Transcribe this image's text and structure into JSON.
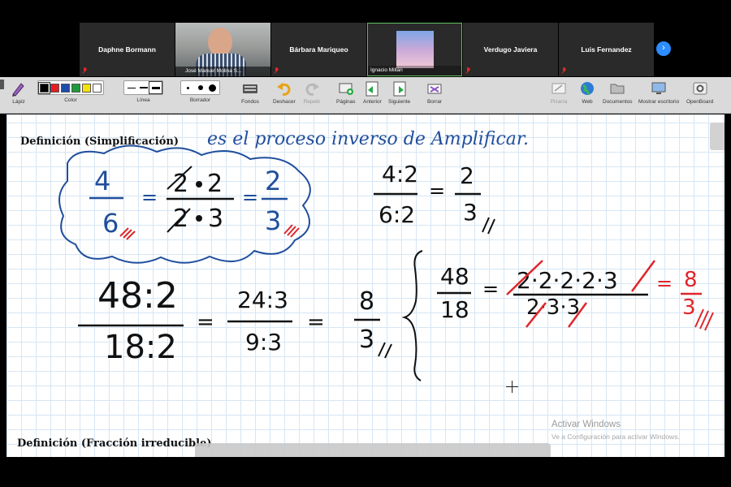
{
  "participants": [
    {
      "name": "Daphne Bormann",
      "muted": true
    },
    {
      "name": "José Manuel Molina S...",
      "muted": false,
      "video": true
    },
    {
      "name": "Bárbara Mariqueo",
      "muted": true
    },
    {
      "name": "Ignacio Millán",
      "muted": false,
      "photo": true
    },
    {
      "name": "Verdugo Javiera",
      "muted": true
    },
    {
      "name": "Luis Fernandez",
      "muted": true
    }
  ],
  "toolbar": {
    "pen": "Lápiz",
    "color": "Color",
    "line": "Línea",
    "eraser": "Borrador",
    "backgrounds": "Fondos",
    "undo": "Deshacer",
    "redo": "Repetir",
    "pages": "Páginas",
    "previous": "Anterior",
    "next": "Siguiente",
    "clear": "Borrar",
    "board": "Pizarra",
    "web": "Web",
    "documents": "Documentos",
    "show_desktop": "Mostrar escritorio",
    "openboard": "OpenBoard"
  },
  "colors": {
    "swatches": [
      "#000000",
      "#e31e24",
      "#1d4ea8",
      "#1f9a3a",
      "#f4e20b"
    ],
    "ink_blue": "#1f4e9c",
    "ink_black": "#111111",
    "ink_red": "#e0252a",
    "accent": "#2d8cff"
  },
  "board": {
    "title_1": "Definición (Simplificación)",
    "handwriting_1": "es el proceso inverso de Amplificar.",
    "title_2": "Definición (Fracción irreducible)",
    "ink": {
      "n4": "4",
      "n6": "6",
      "n2a": "2",
      "n2b": "2",
      "n3a": "3",
      "n2c": "2",
      "n3b": "3",
      "eq": "=",
      "d4": "4:2",
      "d6": "6:2",
      "r2": "2",
      "r3": "3",
      "big48": "48:2",
      "big18": "18:2",
      "m24": "24:3",
      "m9": "9:3",
      "f8": "8",
      "f3": "3",
      "b48": "48",
      "b18": "18",
      "prod_top": "2·2·2·2·3",
      "prod_bot": "2·3·3",
      "res8": "8",
      "res3": "3"
    }
  },
  "watermark": {
    "line1": "Activar Windows",
    "line2": "Ve a Configuración para activar Windows."
  }
}
